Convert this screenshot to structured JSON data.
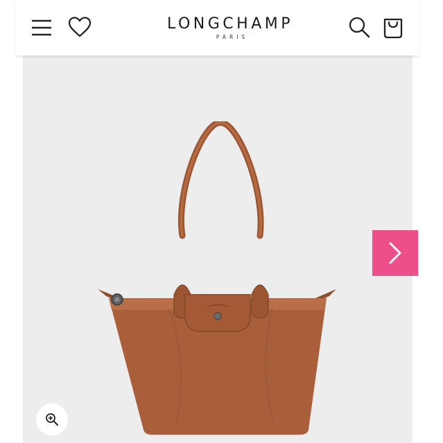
{
  "header": {
    "menu_icon": "hamburger-menu-icon",
    "wishlist_icon": "heart-icon",
    "brand_name": "LONGCHAMP",
    "brand_subtitle": "PARIS",
    "search_icon": "search-icon",
    "cart_icon": "shopping-bag-icon"
  },
  "product": {
    "image": "tote-bag-product-image",
    "next_icon": "chevron-right-icon",
    "zoom_icon": "zoom-in-icon"
  },
  "colors": {
    "accent_pink": "#ec4f8a",
    "stage_bg": "#ededed",
    "bag_leather": "#a9603a"
  }
}
